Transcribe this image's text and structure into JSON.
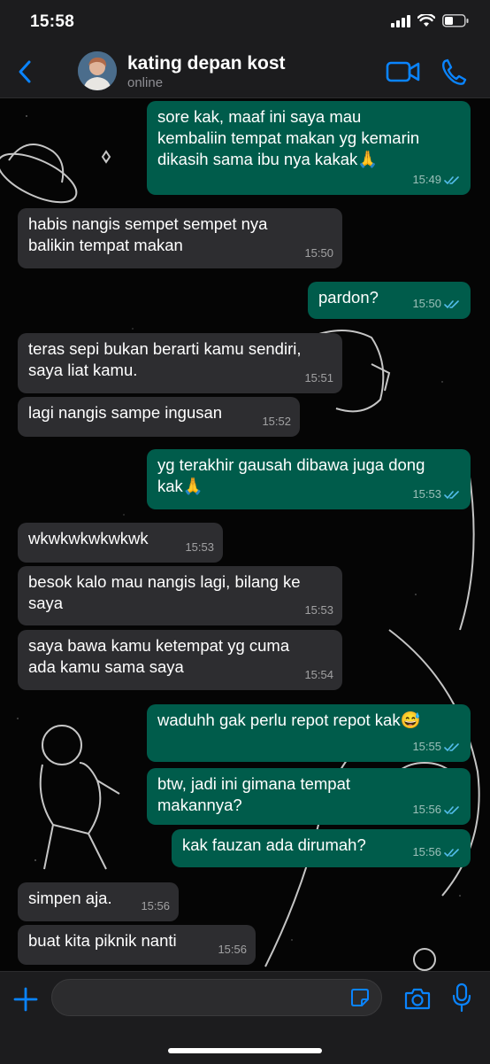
{
  "status_bar": {
    "time": "15:58"
  },
  "header": {
    "contact_name": "kating depan kost",
    "contact_status": "online"
  },
  "messages": [
    {
      "dir": "out",
      "text": "sore kak, maaf ini saya mau\nkembaliin tempat makan yg kemarin\ndikasih sama ibu nya kakak🙏",
      "time": "15:49"
    },
    {
      "dir": "in",
      "text": "habis nangis sempet sempet nya\nbalikin tempat makan",
      "time": "15:50"
    },
    {
      "dir": "out",
      "text": "pardon?",
      "time": "15:50"
    },
    {
      "dir": "in",
      "text": "teras sepi bukan berarti kamu sendiri,\nsaya liat kamu.",
      "time": "15:51"
    },
    {
      "dir": "in",
      "text": "lagi nangis sampe ingusan",
      "time": "15:52"
    },
    {
      "dir": "out",
      "text": "yg terakhir gausah dibawa juga dong\nkak🙏",
      "time": "15:53"
    },
    {
      "dir": "in",
      "text": "wkwkwkwkwkwk",
      "time": "15:53"
    },
    {
      "dir": "in",
      "text": "besok kalo mau nangis lagi, bilang ke\nsaya",
      "time": "15:53"
    },
    {
      "dir": "in",
      "text": "saya bawa kamu ketempat yg cuma\nada kamu sama saya",
      "time": "15:54"
    },
    {
      "dir": "out",
      "text": "waduhh gak perlu repot repot kak😅",
      "time": "15:55"
    },
    {
      "dir": "out",
      "text": "btw, jadi ini gimana tempat\nmakannya?",
      "time": "15:56"
    },
    {
      "dir": "out",
      "text": "kak fauzan ada dirumah?",
      "time": "15:56"
    },
    {
      "dir": "in",
      "text": "simpen aja.",
      "time": "15:56"
    },
    {
      "dir": "in",
      "text": "buat kita piknik nanti",
      "time": "15:56"
    }
  ],
  "input": {
    "placeholder": ""
  },
  "colors": {
    "accent": "#0a84ff",
    "outgoing_bubble": "#005c4b",
    "incoming_bubble": "#2d2d30",
    "read_ticks": "#53bdeb"
  },
  "icons": [
    "back-chevron-icon",
    "video-call-icon",
    "phone-call-icon",
    "plus-icon",
    "sticker-icon",
    "camera-icon",
    "microphone-icon",
    "signal-icon",
    "wifi-icon",
    "battery-icon"
  ]
}
